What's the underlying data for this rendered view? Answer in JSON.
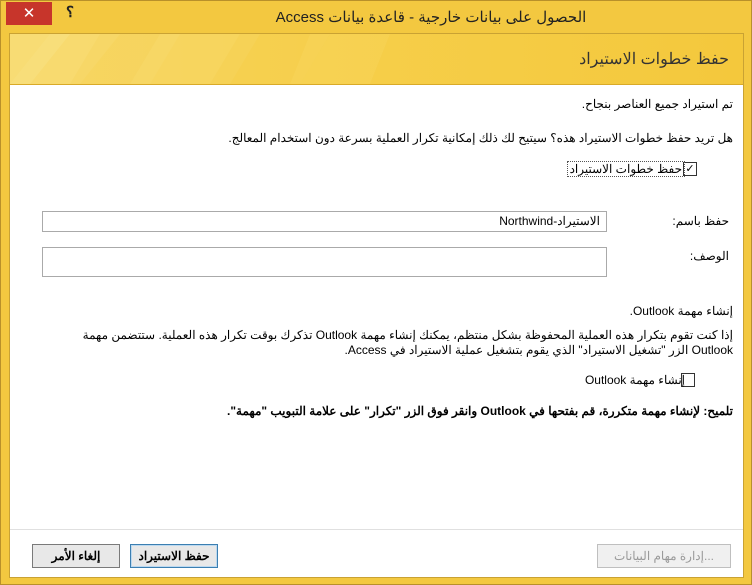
{
  "window": {
    "title": "الحصول على بيانات خارجية - قاعدة بيانات Access",
    "close_glyph": "✕",
    "help_glyph": "؟"
  },
  "banner": {
    "title": "حفظ خطوات الاستيراد"
  },
  "messages": {
    "success": "تم استيراد جميع العناصر بنجاح.",
    "question": "هل تريد حفظ خطوات الاستيراد هذه؟ سيتيح لك ذلك إمكانية تكرار العملية بسرعة دون استخدام المعالج."
  },
  "save_steps": {
    "label": "حفظ خطوات الاستيراد",
    "checked": true,
    "check_glyph": "✓"
  },
  "save_as": {
    "label": "حفظ باسم:",
    "value": "الاستيراد-Northwind"
  },
  "description": {
    "label": "الوصف:",
    "value": ""
  },
  "outlook": {
    "section_title": "إنشاء مهمة Outlook.",
    "info": "إذا كنت تقوم بتكرار هذه العملية المحفوظة بشكل منتظم، يمكنك إنشاء مهمة Outlook تذكرك بوقت تكرار هذه العملية. ستتضمن مهمة Outlook الزر \"تشغيل الاستيراد\" الذي يقوم بتشغيل عملية الاستيراد في Access.",
    "checkbox_label": "إنشاء مهمة Outlook",
    "checked": false,
    "tip": "تلميح: لإنشاء مهمة متكررة، قم بفتحها في Outlook وانقر فوق الزر \"تكرار\" على علامة التبويب \"مهمة\"."
  },
  "buttons": {
    "manage": "إدارة مهام البيانات...",
    "save_import": "حفظ الاستيراد",
    "cancel": "إلغاء الأمر"
  }
}
